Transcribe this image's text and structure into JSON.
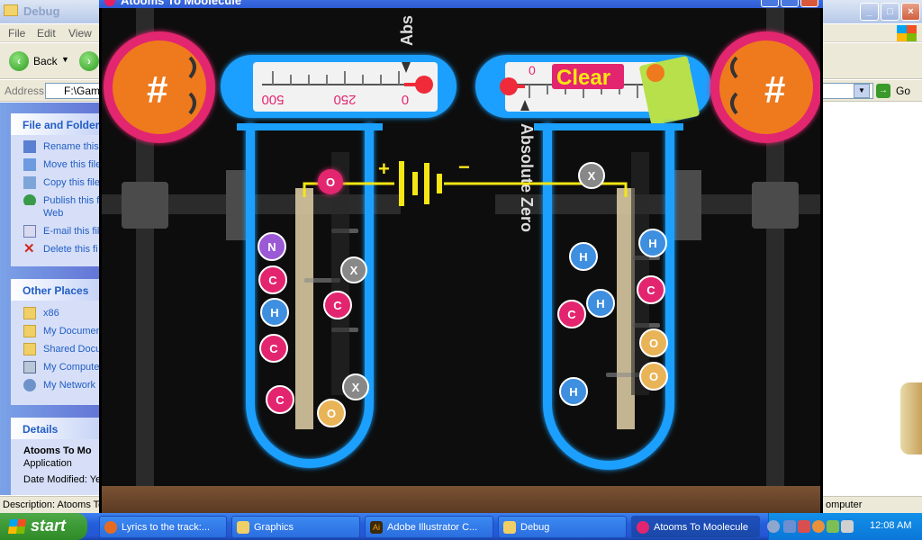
{
  "explorer": {
    "title": "Debug",
    "menus": [
      "File",
      "Edit",
      "View"
    ],
    "back_label": "Back",
    "address_label": "Address",
    "address_value": "F:\\Game",
    "go_label": "Go",
    "file_tasks": {
      "heading": "File and Folder",
      "items": [
        "Rename this",
        "Move this file",
        "Copy this file",
        "Publish this f",
        "Web",
        "E-mail this file",
        "Delete this fi"
      ]
    },
    "other_places": {
      "heading": "Other Places",
      "items": [
        "x86",
        "My Documen",
        "Shared Docu",
        "My Compute",
        "My Network"
      ]
    },
    "details": {
      "heading": "Details",
      "name": "Atooms To Mo",
      "type": "Application",
      "modified": "Date Modified: Ye"
    },
    "status_left": "Description: Atooms To",
    "status_right": "omputer"
  },
  "game": {
    "title": "Atooms To Moolecule",
    "thermo_left": {
      "ticks": [
        "500",
        "250",
        "0"
      ],
      "label": "Abs"
    },
    "thermo_right": {
      "tick": "0",
      "clear_label": "Clear",
      "label": "Absolute Zero"
    },
    "battery": {
      "plus": "+",
      "minus": "−"
    },
    "atoms_left": [
      "N",
      "O",
      "C",
      "H",
      "C",
      "C",
      "X",
      "C",
      "X",
      "O"
    ],
    "atoms_right": [
      "X",
      "H",
      "H",
      "C",
      "C",
      "H",
      "O",
      "O",
      "H"
    ],
    "colors": {
      "hydrogen": "#3f8fe0",
      "carbon": "#e3256f",
      "oxygen": "#e9b457",
      "nitrogen": "#9b59d6",
      "unknown": "#888888",
      "tube": "#1aa0ff",
      "wire": "#f5e614",
      "bulb": "#ee7a1d"
    }
  },
  "taskbar": {
    "start_label": "start",
    "tasks": [
      {
        "label": "Lyrics to the track:...",
        "icon": "firefox-icon"
      },
      {
        "label": "Graphics",
        "icon": "folder-icon"
      },
      {
        "label": "Adobe Illustrator C...",
        "icon": "illustrator-icon"
      },
      {
        "label": "Debug",
        "icon": "folder-icon"
      },
      {
        "label": "Atooms To Moolecule",
        "icon": "game-icon"
      }
    ],
    "clock": "12:08 AM"
  }
}
